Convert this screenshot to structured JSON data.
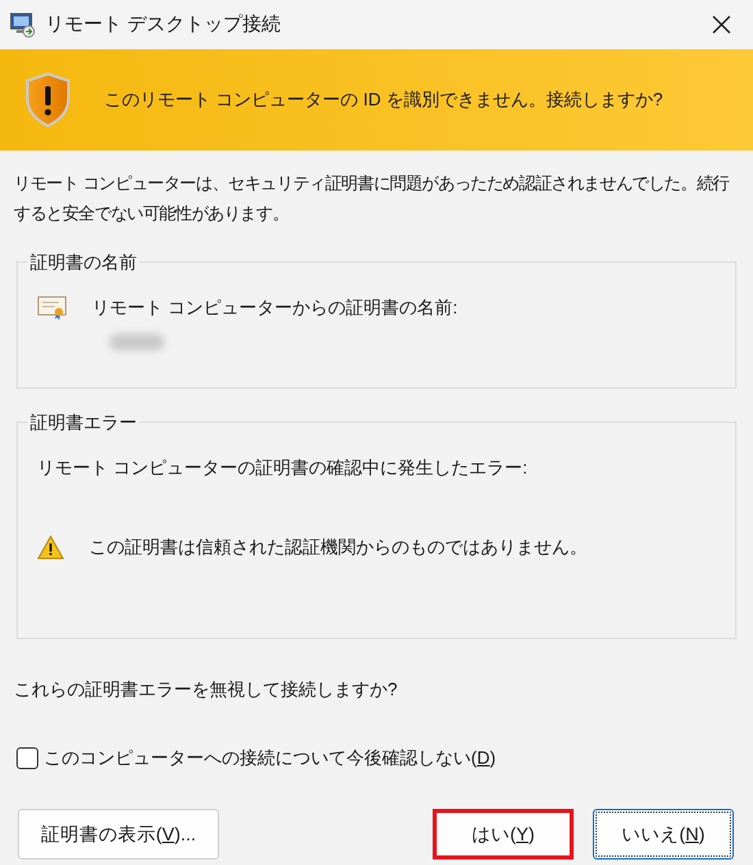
{
  "window": {
    "title": "リモート デスクトップ接続"
  },
  "banner": {
    "message": "このリモート コンピューターの ID を識別できません。接続しますか?"
  },
  "description": "リモート コンピューターは、セキュリティ証明書に問題があったため認証されませんでした。続行すると安全でない可能性があります。",
  "certificate_name_group": {
    "title": "証明書の名前",
    "label": "リモート コンピューターからの証明書の名前:",
    "value_redacted": true
  },
  "certificate_error_group": {
    "title": "証明書エラー",
    "label": "リモート コンピューターの証明書の確認中に発生したエラー:",
    "errors": [
      "この証明書は信頼された認証機関からのものではありません。"
    ]
  },
  "question": "これらの証明書エラーを無視して接続しますか?",
  "checkbox": {
    "label": {
      "text": "このコンピューターへの接続について今後確認しない(",
      "key": "D",
      "end": ")"
    },
    "checked": false
  },
  "buttons": [
    {
      "label": {
        "text": "証明書の表示(",
        "key": "V",
        "end": ")..."
      },
      "highlighted": false,
      "focused": false
    },
    {
      "label": {
        "text": "はい(",
        "key": "Y",
        "end": ")"
      },
      "highlighted": true,
      "focused": false
    },
    {
      "label": {
        "text": "いいえ(",
        "key": "N",
        "end": ")"
      },
      "highlighted": false,
      "focused": true
    }
  ]
}
